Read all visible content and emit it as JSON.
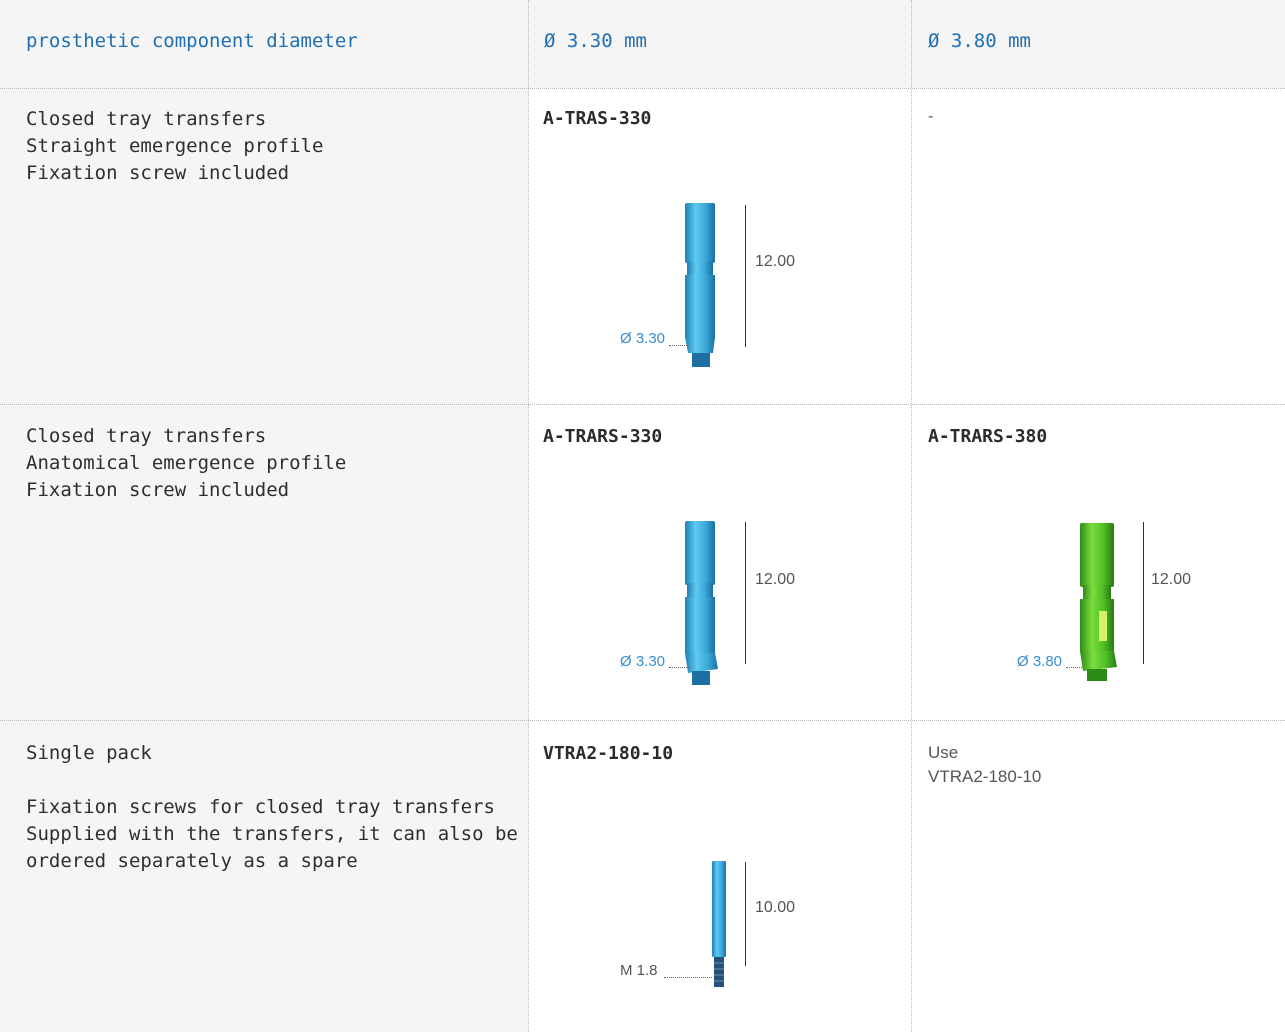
{
  "header": {
    "label": "prosthetic component diameter",
    "col1": "Ø 3.30 mm",
    "col2": "Ø 3.80 mm"
  },
  "rows": [
    {
      "description": [
        "Closed tray transfers",
        "Straight emergence profile",
        "Fixation screw included"
      ],
      "col1": {
        "code": "A-TRAS-330",
        "length": "12.00",
        "diameter": "Ø 3.30",
        "color": "#3fb4e0"
      },
      "col2": {
        "text": "-"
      }
    },
    {
      "description": [
        "Closed tray transfers",
        "Anatomical emergence profile",
        "Fixation screw included"
      ],
      "col1": {
        "code": "A-TRARS-330",
        "length": "12.00",
        "diameter": "Ø 3.30",
        "color": "#3fb4e0"
      },
      "col2": {
        "code": "A-TRARS-380",
        "length": "12.00",
        "diameter": "Ø 3.80",
        "color": "#5cc832"
      }
    },
    {
      "description": [
        "Single pack",
        "",
        "Fixation screws for closed tray transfers",
        "Supplied with the transfers, it can also be",
        "ordered separately as a spare"
      ],
      "col1": {
        "code": "VTRA2-180-10",
        "length": "10.00",
        "thread": "M 1.8",
        "color": "#4aaee0"
      },
      "col2": {
        "text_lines": [
          "Use",
          "VTRA2-180-10"
        ]
      }
    }
  ]
}
